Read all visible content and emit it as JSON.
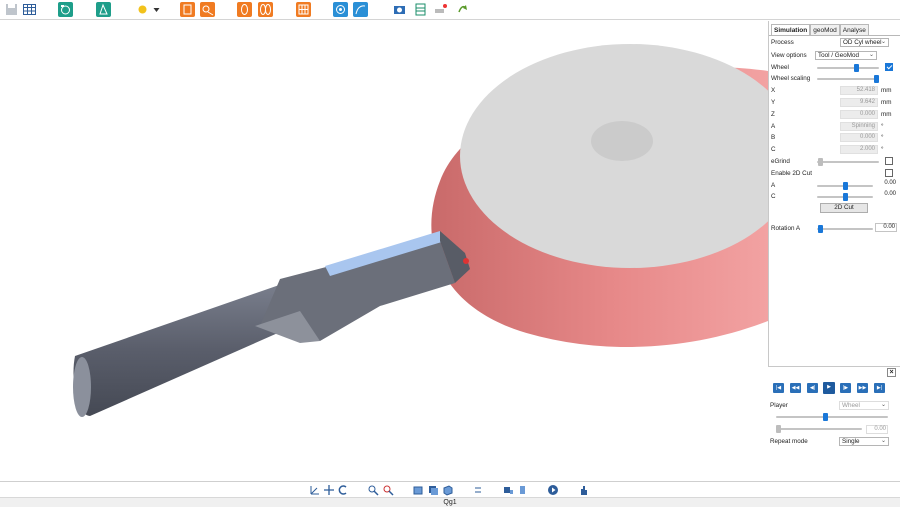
{
  "toolbar": {
    "icons": [
      "save-icon",
      "table-icon",
      "wheel-setup-icon",
      "grind-icon",
      "light-icon",
      "dropdown-arrow-icon",
      "tool-orange-icon",
      "tool-orange-2-icon",
      "wheel-orange-icon",
      "wheels-orange-icon",
      "grid-orange-icon",
      "target-blue-icon",
      "path-blue-icon",
      "camera-icon",
      "spreadsheet-icon",
      "eraser-icon",
      "arrow-green-icon"
    ]
  },
  "tabs": {
    "simulation": "Simulation",
    "geomod": "geoMod",
    "analyse": "Analyse"
  },
  "fields": {
    "process_label": "Process",
    "process_value": "OD Cyl wheel",
    "view_options_label": "View options",
    "view_options_value": "Tool / GeoMod",
    "wheel_label": "Wheel",
    "wheel_scaling_label": "Wheel scaling",
    "x_label": "X",
    "x_value": "52.418",
    "x_unit": "mm",
    "y_label": "Y",
    "y_value": "9.642",
    "y_unit": "mm",
    "z_label": "Z",
    "z_value": "0.000",
    "z_unit": "mm",
    "a_label": "A",
    "a_value": "Spinning",
    "a_unit": "°",
    "b_label": "B",
    "b_value": "0.000",
    "b_unit": "°",
    "c_label": "C",
    "c_value": "2.000",
    "c_unit": "°",
    "egrind_label": "eGrind",
    "enable2d_label": "Enable 2D Cut",
    "cut_a_label": "A",
    "cut_a_value": "0.00",
    "cut_c_label": "C",
    "cut_c_value": "0.00",
    "cut2d_button": "2D Cut",
    "rotation_a_label": "Rotation A",
    "rotation_a_value": "0.00"
  },
  "player": {
    "close": "×",
    "player_label": "Player",
    "player_value": "Wheel",
    "progress_value": "0.00",
    "repeat_label": "Repeat mode",
    "repeat_value": "Single"
  },
  "status": {
    "text": "Qg1"
  },
  "colors": {
    "accent": "#1977d8",
    "wheel_rim": "#e47f7f",
    "wheel_face": "#d9d9d9",
    "tool_shank": "#5c6070"
  }
}
